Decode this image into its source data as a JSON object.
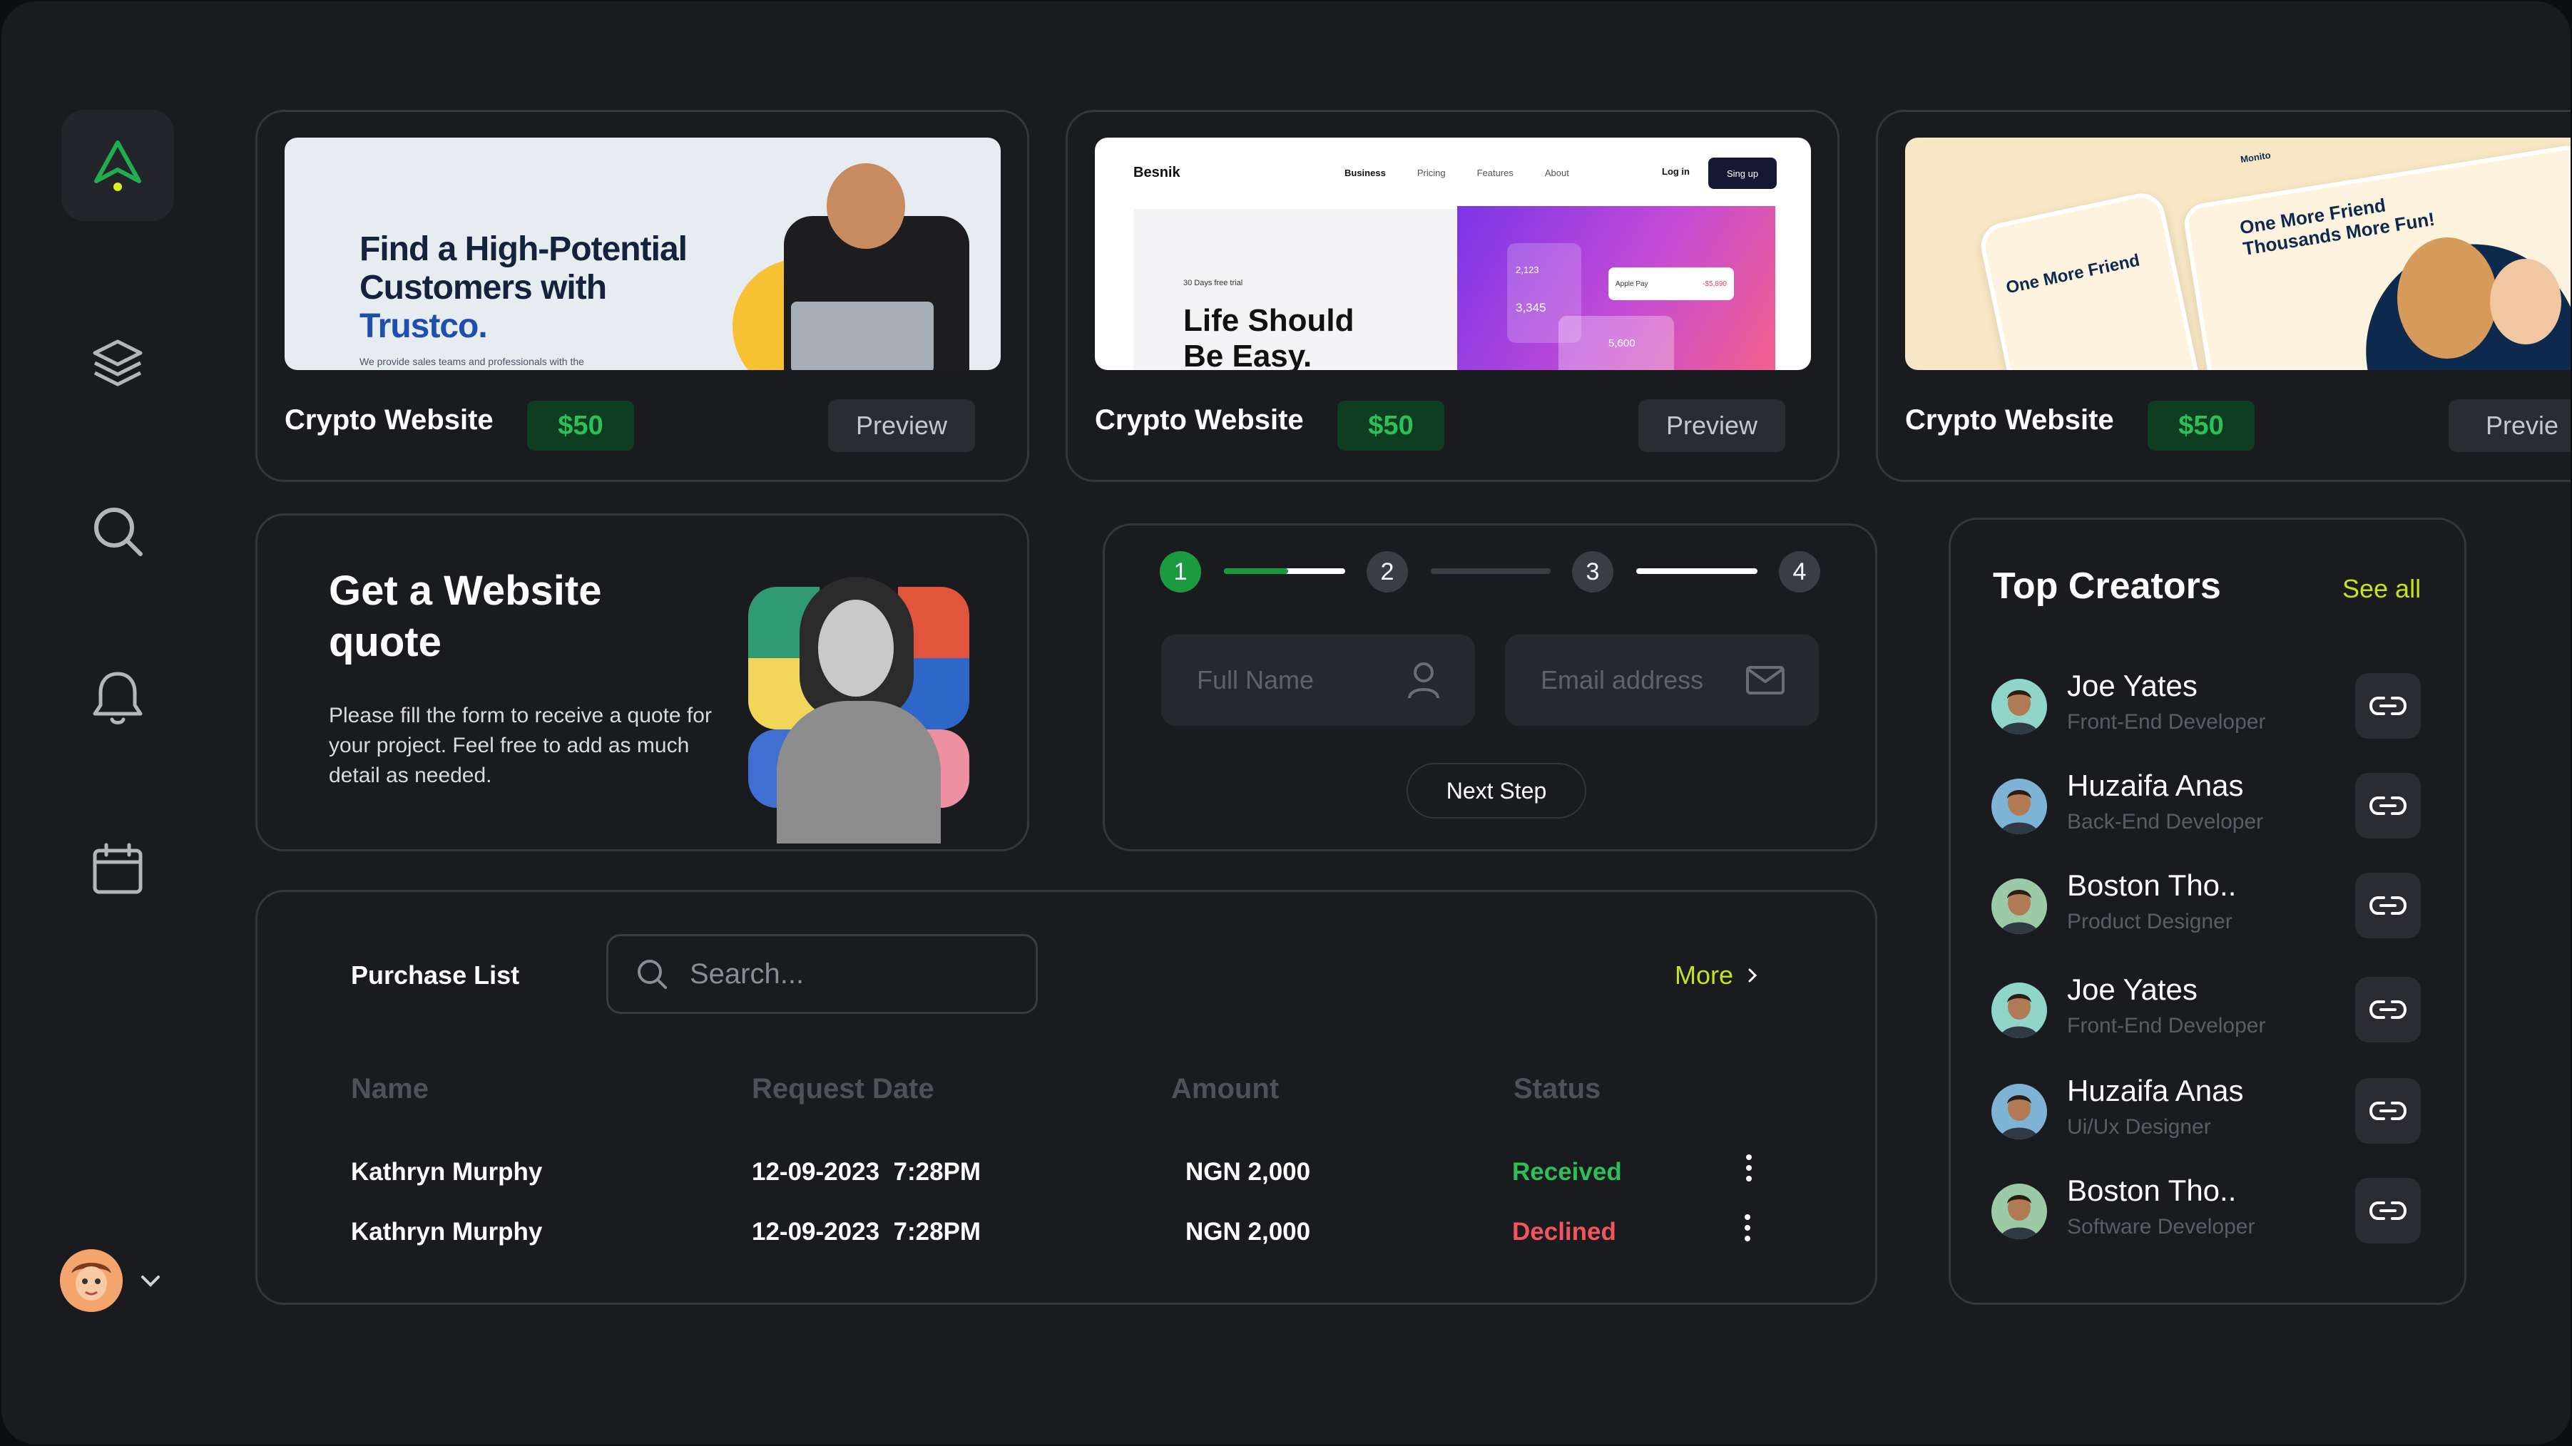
{
  "templates": [
    {
      "title": "Crypto Website",
      "price": "$50",
      "preview": "Preview",
      "hero_lines": [
        "Find a High-Potential",
        "Customers with"
      ],
      "hero_brand": "Trustco.",
      "hero_sub": "We provide sales teams and professionals with the"
    },
    {
      "title": "Crypto Website",
      "price": "$50",
      "preview": "Preview",
      "brand": "Besnik",
      "nav": [
        "Business",
        "Pricing",
        "Features",
        "About"
      ],
      "login": "Log in",
      "signup": "Sing up",
      "trial": "30 Days free trial",
      "hero_lines": [
        "Life Should",
        "Be Easy."
      ],
      "stat1": "2,123",
      "stat2": "3,345",
      "stat3": "5,600",
      "pay": "Apple Pay",
      "pay_amount": "-$5,890"
    },
    {
      "title": "Crypto Website",
      "price": "$50",
      "preview": "Previe",
      "brand": "Monito",
      "hero_lines": [
        "One More Friend",
        "Thousands More Fun!"
      ]
    }
  ],
  "quote": {
    "title": "Get a Website quote",
    "text": "Please fill the form to receive a quote for your project. Feel free to add as much detail as needed."
  },
  "form": {
    "steps": [
      "1",
      "2",
      "3",
      "4"
    ],
    "current_step": 1,
    "full_name_placeholder": "Full Name",
    "email_placeholder": "Email address",
    "next_label": "Next Step"
  },
  "purchase": {
    "title": "Purchase List",
    "search_placeholder": "Search...",
    "more": "More",
    "columns": [
      "Name",
      "Request Date",
      "Amount",
      "Status"
    ],
    "rows": [
      {
        "name": "Kathryn Murphy",
        "date": "12-09-2023  7:28PM",
        "amount": "NGN 2,000",
        "status": "Received"
      },
      {
        "name": "Kathryn Murphy",
        "date": "12-09-2023  7:28PM",
        "amount": "NGN 2,000",
        "status": "Declined"
      }
    ]
  },
  "creators": {
    "title": "Top Creators",
    "see_all": "See all",
    "items": [
      {
        "name": "Joe Yates",
        "role": "Front-End Developer"
      },
      {
        "name": "Huzaifa Anas",
        "role": "Back-End Developer"
      },
      {
        "name": "Boston Tho..",
        "role": "Product Designer"
      },
      {
        "name": "Joe Yates",
        "role": "Front-End Developer"
      },
      {
        "name": "Huzaifa Anas",
        "role": "Ui/Ux Designer"
      },
      {
        "name": "Boston Tho..",
        "role": "Software Developer"
      }
    ]
  },
  "colors": {
    "accent": "#c7e21a",
    "success": "#2fbf57",
    "danger": "#f0565b",
    "surface": "#1a1b1f"
  },
  "icons": {
    "sidebar": [
      "logo-arrow-icon",
      "layers-icon",
      "search-icon",
      "bell-icon",
      "calendar-icon"
    ]
  }
}
